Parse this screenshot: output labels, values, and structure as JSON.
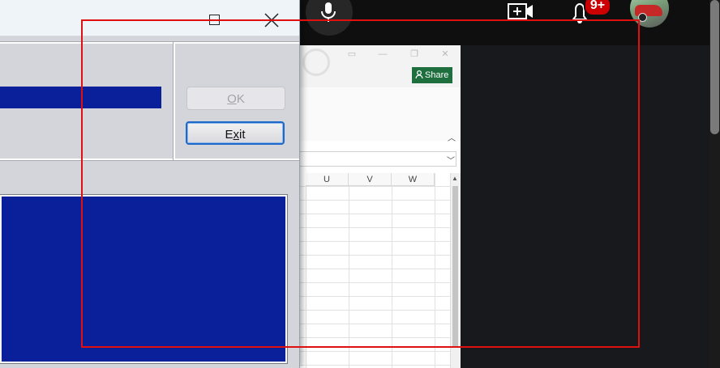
{
  "youtube": {
    "notification_count": "9+",
    "icons": [
      "search-icon",
      "microphone-icon",
      "create-video-icon",
      "notifications-bell-icon",
      "avatar"
    ]
  },
  "excel": {
    "share_label": "Share",
    "column_headers": [
      "U",
      "V",
      "W"
    ],
    "accent": "#1e6e3e"
  },
  "dialog": {
    "ok_label": "OK",
    "ok_accel": "O",
    "exit_label_pre": "E",
    "exit_accel": "x",
    "exit_label_post": "it",
    "progress_fraction": 1.0,
    "colors": {
      "fill": "#0a1f9a",
      "face": "#d4d4db",
      "focus": "#1d68c8"
    }
  },
  "overlay": {
    "color": "#e01010"
  }
}
